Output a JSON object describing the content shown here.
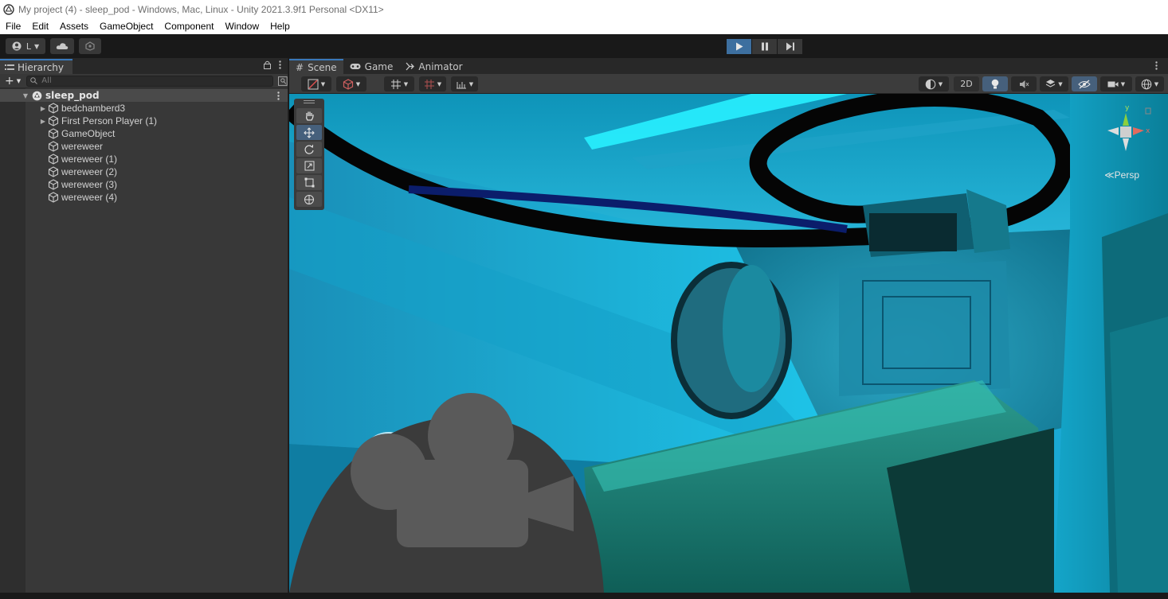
{
  "window": {
    "title": "My project (4) - sleep_pod - Windows, Mac, Linux - Unity 2021.3.9f1 Personal <DX11>"
  },
  "menu": [
    "File",
    "Edit",
    "Assets",
    "GameObject",
    "Component",
    "Window",
    "Help"
  ],
  "toolbar": {
    "account_label": "L",
    "play_icon": "play-icon",
    "pause_icon": "pause-icon",
    "step_icon": "step-icon"
  },
  "hierarchy": {
    "tab_label": "Hierarchy",
    "search_placeholder": "All",
    "scene_name": "sleep_pod",
    "items": [
      {
        "label": "bedchamberd3",
        "expandable": true
      },
      {
        "label": "First Person Player (1)",
        "expandable": true
      },
      {
        "label": "GameObject",
        "expandable": false
      },
      {
        "label": "wereweer",
        "expandable": false
      },
      {
        "label": "wereweer (1)",
        "expandable": false
      },
      {
        "label": "wereweer (2)",
        "expandable": false
      },
      {
        "label": "wereweer (3)",
        "expandable": false
      },
      {
        "label": "wereweer (4)",
        "expandable": false
      }
    ]
  },
  "scene_tabs": [
    {
      "label": "Scene",
      "icon": "grid-icon",
      "active": true
    },
    {
      "label": "Game",
      "icon": "gamepad-icon",
      "active": false
    },
    {
      "label": "Animator",
      "icon": "animator-icon",
      "active": false
    }
  ],
  "scene_toolbar": {
    "mode_2d": "2D"
  },
  "viewport": {
    "projection_label": "Persp"
  },
  "colors": {
    "accent": "#3a79bb",
    "play_active": "#3d6f9f",
    "scene_cyan": "#19b9e0"
  }
}
